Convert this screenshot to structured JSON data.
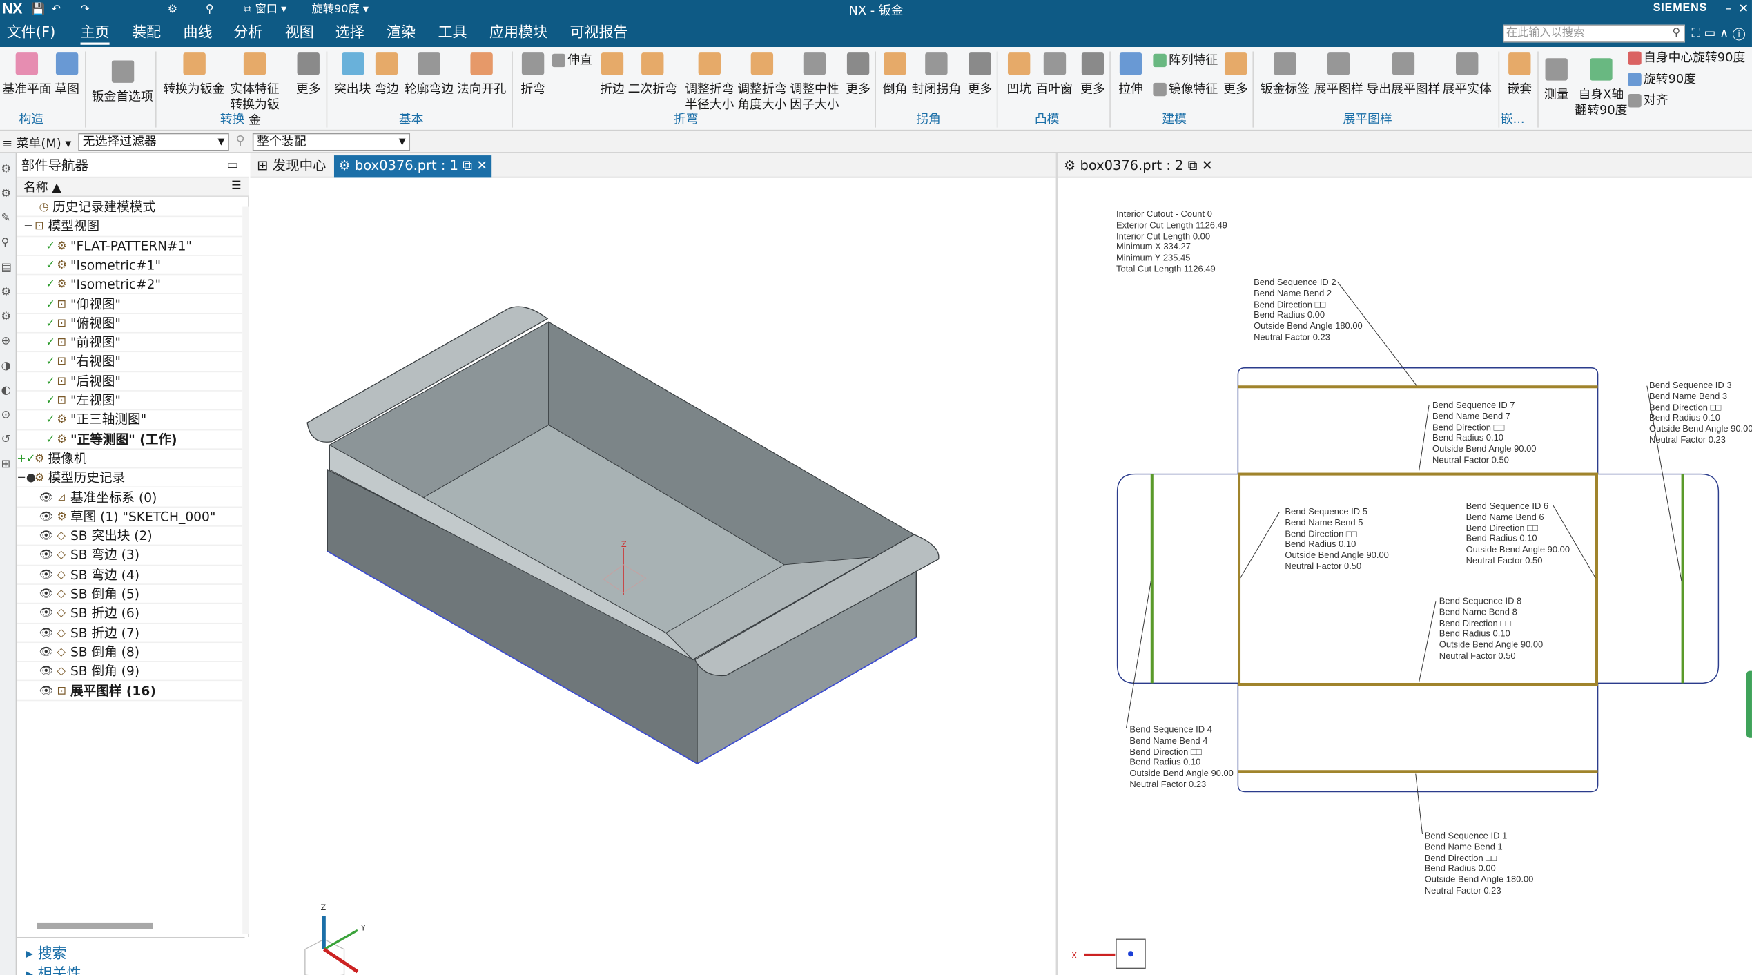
{
  "app": {
    "logo": "NX",
    "title": "NX - 钣金",
    "brand": "SIEMENS",
    "quick_menu_window": "窗口",
    "quick_cmd": "旋转90度"
  },
  "menu": {
    "file": "文件(F)",
    "tabs": [
      "主页",
      "装配",
      "曲线",
      "分析",
      "视图",
      "选择",
      "渲染",
      "工具",
      "应用模块",
      "可视报告"
    ],
    "active": "主页",
    "search_placeholder": "在此输入以搜索"
  },
  "ribbon": {
    "buttons": [
      "基准平面",
      "草图",
      "钣金首选项",
      "转换为钣金",
      "实体特征转换为钣金",
      "更多",
      "突出块",
      "弯边",
      "轮廓弯边",
      "法向开孔",
      "折弯",
      "伸直",
      "折边",
      "二次折弯",
      "调整折弯半径大小",
      "调整折弯角度大小",
      "调整中性因子大小",
      "更多",
      "倒角",
      "封闭拐角",
      "更多",
      "凹坑",
      "百叶窗",
      "更多",
      "拉伸",
      "阵列特征",
      "镜像特征",
      "更多",
      "钣金标签",
      "展平图样",
      "导出展平图样",
      "展平实体",
      "嵌套",
      "测量",
      "自身X轴翻转90度",
      "自身中心旋转90度",
      "旋转90度",
      "对齐"
    ],
    "groups": [
      "构造",
      "转换",
      "基本",
      "折弯",
      "拐角",
      "凸模",
      "建模",
      "展平图样",
      "嵌..."
    ]
  },
  "selection": {
    "menu": "菜单(M)",
    "filter": "无选择过滤器",
    "scope": "整个装配"
  },
  "navigator": {
    "title": "部件导航器",
    "column": "名称",
    "items": [
      "历史记录建模模式",
      "模型视图",
      "\"FLAT-PATTERN#1\"",
      "\"Isometric#1\"",
      "\"Isometric#2\"",
      "\"仰视图\"",
      "\"俯视图\"",
      "\"前视图\"",
      "\"右视图\"",
      "\"后视图\"",
      "\"左视图\"",
      "\"正三轴测图\"",
      "\"正等测图\" (工作)",
      "摄像机",
      "模型历史记录",
      "基准坐标系 (0)",
      "草图 (1) \"SKETCH_000\"",
      "SB 突出块 (2)",
      "SB 弯边 (3)",
      "SB 弯边 (4)",
      "SB 倒角 (5)",
      "SB 折边 (6)",
      "SB 折边 (7)",
      "SB 倒角 (8)",
      "SB 倒角 (9)",
      "展平图样 (16)"
    ],
    "panels": [
      "搜索",
      "相关性"
    ]
  },
  "tabs": {
    "discover": "发现中心",
    "doc1": "box0376.prt : 1",
    "doc2": "box0376.prt : 2"
  },
  "flat": {
    "summary": [
      "Interior Cutout - Count 0",
      "Exterior Cut Length 1126.49",
      "Interior Cut Length 0.00",
      "Minimum X 334.27",
      "Minimum Y 235.45",
      "Total Cut Length 1126.49"
    ],
    "bend2": [
      "Bend Sequence ID 2",
      "Bend Name Bend 2",
      "Bend Direction □□",
      "Bend Radius 0.00",
      "Outside Bend Angle 180.00",
      "Neutral Factor 0.23"
    ],
    "bend7": [
      "Bend Sequence ID 7",
      "Bend Name Bend 7",
      "Bend Direction □□",
      "Bend Radius 0.10",
      "Outside Bend Angle 90.00",
      "Neutral Factor 0.50"
    ],
    "bend3": [
      "Bend Sequence ID 3",
      "Bend Name Bend 3",
      "Bend Direction □□",
      "Bend Radius 0.10",
      "Outside Bend Angle 90.00",
      "Neutral Factor 0.23"
    ],
    "bend5": [
      "Bend Sequence ID 5",
      "Bend Name Bend 5",
      "Bend Direction □□",
      "Bend Radius 0.10",
      "Outside Bend Angle 90.00",
      "Neutral Factor 0.50"
    ],
    "bend6": [
      "Bend Sequence ID 6",
      "Bend Name Bend 6",
      "Bend Direction □□",
      "Bend Radius 0.10",
      "Outside Bend Angle 90.00",
      "Neutral Factor 0.50"
    ],
    "bend8": [
      "Bend Sequence ID 8",
      "Bend Name Bend 8",
      "Bend Direction □□",
      "Bend Radius 0.10",
      "Outside Bend Angle 90.00",
      "Neutral Factor 0.50"
    ],
    "bend4": [
      "Bend Sequence ID 4",
      "Bend Name Bend 4",
      "Bend Direction □□",
      "Bend Radius 0.10",
      "Outside Bend Angle 90.00",
      "Neutral Factor 0.23"
    ],
    "bend1": [
      "Bend Sequence ID 1",
      "Bend Name Bend 1",
      "Bend Direction □□",
      "Bend Radius 0.00",
      "Outside Bend Angle 180.00",
      "Neutral Factor 0.23"
    ]
  },
  "colors": {
    "brand": "#0e5a85",
    "accent": "#1b6fa8",
    "bend_line": "#a0842c"
  }
}
